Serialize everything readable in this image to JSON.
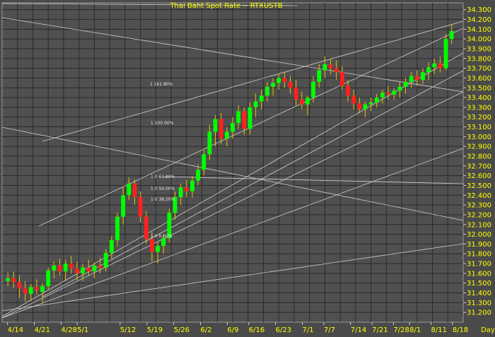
{
  "chart_data": {
    "type": "candlestick",
    "title": "Thai Baht Spot Rate -- RTXUSTB",
    "x_unit_label": "Day",
    "up_color": "#00ff00",
    "down_color": "#ff2020",
    "grid": true,
    "ylim": [
      31.1,
      34.37
    ],
    "y_ticks": [
      "31.200",
      "31.300",
      "31.400",
      "31.500",
      "31.600",
      "31.700",
      "31.800",
      "31.900",
      "32.000",
      "32.100",
      "32.200",
      "32.300",
      "32.400",
      "32.500",
      "32.600",
      "32.700",
      "32.800",
      "32.900",
      "33.000",
      "33.100",
      "33.200",
      "33.300",
      "33.400",
      "33.500",
      "33.600",
      "33.700",
      "33.800",
      "33.900",
      "34.000",
      "34.100",
      "34.200",
      "34.300"
    ],
    "x_ticks": [
      "4/14",
      "4/21",
      "4/28",
      "5/1",
      "5/12",
      "5/19",
      "5/26",
      "6/2",
      "6/9",
      "6/16",
      "6/23",
      "7/1",
      "7/7",
      "7/14",
      "7/21",
      "7/28",
      "8/1",
      "8/11",
      "8/18"
    ],
    "fib_labels": [
      "1 161.80%",
      "1 100.00%",
      "1 0 61.80%",
      "1 0 50.00%",
      "1 0 38.20%",
      "1 0 0.00%"
    ],
    "candles": [
      {
        "o": 31.52,
        "h": 31.61,
        "l": 31.47,
        "c": 31.55
      },
      {
        "o": 31.55,
        "h": 31.62,
        "l": 31.45,
        "c": 31.51
      },
      {
        "o": 31.51,
        "h": 31.58,
        "l": 31.35,
        "c": 31.45
      },
      {
        "o": 31.45,
        "h": 31.52,
        "l": 31.31,
        "c": 31.39
      },
      {
        "o": 31.39,
        "h": 31.49,
        "l": 31.32,
        "c": 31.46
      },
      {
        "o": 31.46,
        "h": 31.54,
        "l": 31.38,
        "c": 31.43
      },
      {
        "o": 31.41,
        "h": 31.5,
        "l": 31.3,
        "c": 31.47
      },
      {
        "o": 31.47,
        "h": 31.66,
        "l": 31.43,
        "c": 31.63
      },
      {
        "o": 31.63,
        "h": 31.72,
        "l": 31.55,
        "c": 31.68
      },
      {
        "o": 31.68,
        "h": 31.75,
        "l": 31.58,
        "c": 31.62
      },
      {
        "o": 31.62,
        "h": 31.74,
        "l": 31.52,
        "c": 31.7
      },
      {
        "o": 31.7,
        "h": 31.78,
        "l": 31.6,
        "c": 31.65
      },
      {
        "o": 31.65,
        "h": 31.72,
        "l": 31.53,
        "c": 31.6
      },
      {
        "o": 31.6,
        "h": 31.7,
        "l": 31.52,
        "c": 31.66
      },
      {
        "o": 31.66,
        "h": 31.74,
        "l": 31.58,
        "c": 31.62
      },
      {
        "o": 31.62,
        "h": 31.71,
        "l": 31.55,
        "c": 31.68
      },
      {
        "o": 31.68,
        "h": 31.76,
        "l": 31.6,
        "c": 31.66
      },
      {
        "o": 31.66,
        "h": 31.85,
        "l": 31.62,
        "c": 31.81
      },
      {
        "o": 31.81,
        "h": 31.98,
        "l": 31.75,
        "c": 31.94
      },
      {
        "o": 31.94,
        "h": 32.22,
        "l": 31.88,
        "c": 32.18
      },
      {
        "o": 32.18,
        "h": 32.48,
        "l": 32.1,
        "c": 32.4
      },
      {
        "o": 32.4,
        "h": 32.58,
        "l": 32.35,
        "c": 32.52
      },
      {
        "o": 32.52,
        "h": 32.56,
        "l": 32.3,
        "c": 32.38
      },
      {
        "o": 32.38,
        "h": 32.44,
        "l": 32.12,
        "c": 32.18
      },
      {
        "o": 32.18,
        "h": 32.24,
        "l": 31.9,
        "c": 31.95
      },
      {
        "o": 31.95,
        "h": 32.02,
        "l": 31.72,
        "c": 31.82
      },
      {
        "o": 31.82,
        "h": 31.92,
        "l": 31.7,
        "c": 31.88
      },
      {
        "o": 31.88,
        "h": 32.0,
        "l": 31.8,
        "c": 31.96
      },
      {
        "o": 31.96,
        "h": 32.26,
        "l": 31.92,
        "c": 32.22
      },
      {
        "o": 32.22,
        "h": 32.44,
        "l": 32.15,
        "c": 32.38
      },
      {
        "o": 32.38,
        "h": 32.52,
        "l": 32.3,
        "c": 32.48
      },
      {
        "o": 32.48,
        "h": 32.56,
        "l": 32.38,
        "c": 32.44
      },
      {
        "o": 32.44,
        "h": 32.6,
        "l": 32.38,
        "c": 32.55
      },
      {
        "o": 32.55,
        "h": 32.72,
        "l": 32.5,
        "c": 32.66
      },
      {
        "o": 32.66,
        "h": 32.86,
        "l": 32.6,
        "c": 32.82
      },
      {
        "o": 32.82,
        "h": 33.12,
        "l": 32.76,
        "c": 33.05
      },
      {
        "o": 33.05,
        "h": 33.22,
        "l": 32.9,
        "c": 33.18
      },
      {
        "o": 33.18,
        "h": 33.24,
        "l": 32.92,
        "c": 32.98
      },
      {
        "o": 32.98,
        "h": 33.1,
        "l": 32.9,
        "c": 33.05
      },
      {
        "o": 33.05,
        "h": 33.2,
        "l": 32.98,
        "c": 33.14
      },
      {
        "o": 33.14,
        "h": 33.32,
        "l": 33.08,
        "c": 33.26
      },
      {
        "o": 33.26,
        "h": 33.3,
        "l": 33.02,
        "c": 33.08
      },
      {
        "o": 33.08,
        "h": 33.35,
        "l": 33.02,
        "c": 33.3
      },
      {
        "o": 33.3,
        "h": 33.44,
        "l": 33.2,
        "c": 33.36
      },
      {
        "o": 33.36,
        "h": 33.48,
        "l": 33.28,
        "c": 33.42
      },
      {
        "o": 33.42,
        "h": 33.56,
        "l": 33.36,
        "c": 33.51
      },
      {
        "o": 33.51,
        "h": 33.6,
        "l": 33.42,
        "c": 33.55
      },
      {
        "o": 33.55,
        "h": 33.65,
        "l": 33.48,
        "c": 33.6
      },
      {
        "o": 33.6,
        "h": 33.66,
        "l": 33.5,
        "c": 33.56
      },
      {
        "o": 33.56,
        "h": 33.62,
        "l": 33.44,
        "c": 33.5
      },
      {
        "o": 33.5,
        "h": 33.58,
        "l": 33.32,
        "c": 33.38
      },
      {
        "o": 33.38,
        "h": 33.46,
        "l": 33.28,
        "c": 33.33
      },
      {
        "o": 33.33,
        "h": 33.42,
        "l": 33.22,
        "c": 33.4
      },
      {
        "o": 33.4,
        "h": 33.62,
        "l": 33.35,
        "c": 33.56
      },
      {
        "o": 33.56,
        "h": 33.74,
        "l": 33.5,
        "c": 33.68
      },
      {
        "o": 33.68,
        "h": 33.82,
        "l": 33.6,
        "c": 33.74
      },
      {
        "o": 33.74,
        "h": 33.8,
        "l": 33.64,
        "c": 33.7
      },
      {
        "o": 33.7,
        "h": 33.78,
        "l": 33.58,
        "c": 33.66
      },
      {
        "o": 33.66,
        "h": 33.72,
        "l": 33.48,
        "c": 33.52
      },
      {
        "o": 33.52,
        "h": 33.58,
        "l": 33.36,
        "c": 33.42
      },
      {
        "o": 33.42,
        "h": 33.48,
        "l": 33.28,
        "c": 33.34
      },
      {
        "o": 33.34,
        "h": 33.4,
        "l": 33.24,
        "c": 33.28
      },
      {
        "o": 33.28,
        "h": 33.36,
        "l": 33.2,
        "c": 33.33
      },
      {
        "o": 33.33,
        "h": 33.4,
        "l": 33.26,
        "c": 33.35
      },
      {
        "o": 33.35,
        "h": 33.44,
        "l": 33.3,
        "c": 33.4
      },
      {
        "o": 33.4,
        "h": 33.48,
        "l": 33.34,
        "c": 33.45
      },
      {
        "o": 33.45,
        "h": 33.52,
        "l": 33.38,
        "c": 33.43
      },
      {
        "o": 33.43,
        "h": 33.5,
        "l": 33.38,
        "c": 33.47
      },
      {
        "o": 33.47,
        "h": 33.56,
        "l": 33.4,
        "c": 33.51
      },
      {
        "o": 33.51,
        "h": 33.6,
        "l": 33.44,
        "c": 33.56
      },
      {
        "o": 33.56,
        "h": 33.66,
        "l": 33.5,
        "c": 33.62
      },
      {
        "o": 33.62,
        "h": 33.68,
        "l": 33.52,
        "c": 33.58
      },
      {
        "o": 33.58,
        "h": 33.7,
        "l": 33.54,
        "c": 33.66
      },
      {
        "o": 33.66,
        "h": 33.76,
        "l": 33.58,
        "c": 33.71
      },
      {
        "o": 33.71,
        "h": 33.8,
        "l": 33.64,
        "c": 33.75
      },
      {
        "o": 33.75,
        "h": 33.82,
        "l": 33.66,
        "c": 33.7
      },
      {
        "o": 33.7,
        "h": 34.05,
        "l": 33.68,
        "c": 34.0
      },
      {
        "o": 34.0,
        "h": 34.15,
        "l": 33.95,
        "c": 34.08
      }
    ]
  }
}
